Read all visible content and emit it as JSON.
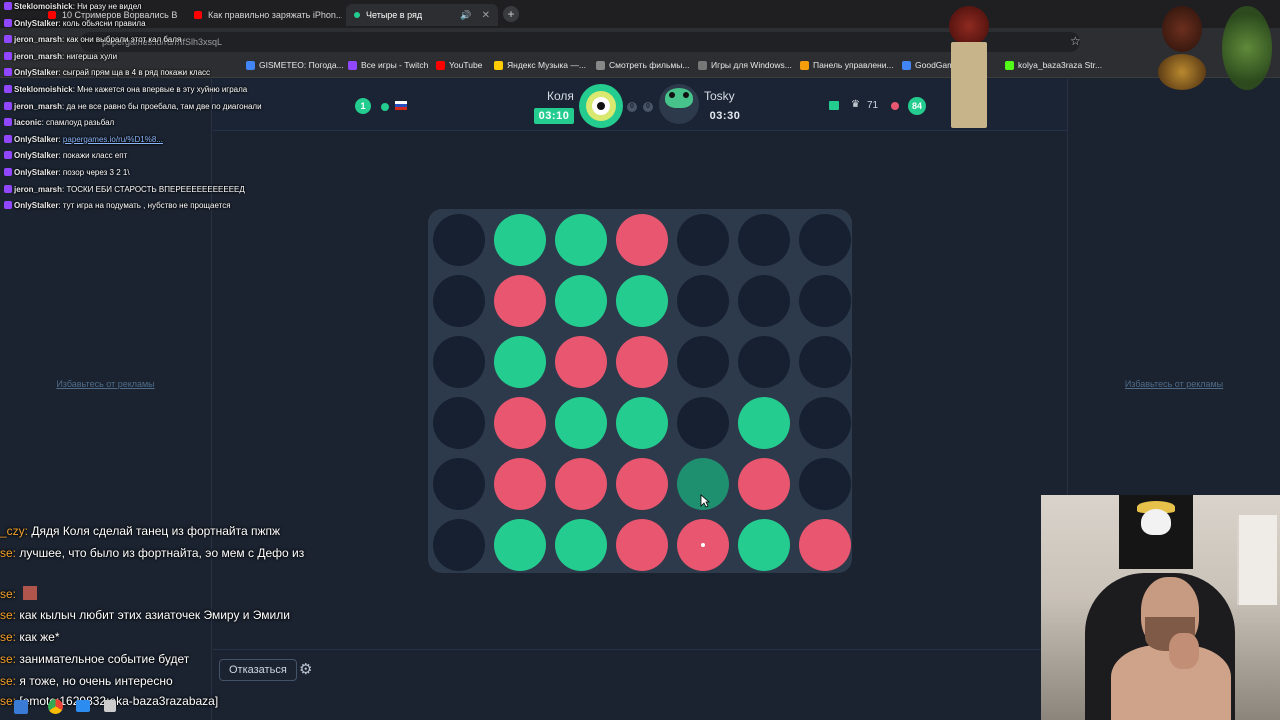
{
  "browser": {
    "tabs": [
      {
        "label": "10 Стримеров Ворвались В Мо...",
        "color": "#ff0000",
        "active": false
      },
      {
        "label": "Как правильно заряжать iPhon...",
        "color": "#ff0000",
        "active": false
      },
      {
        "label": "Четыре в ряд",
        "color": "#24cd8f",
        "active": true
      }
    ],
    "new_tab": "+",
    "url": "papergames.io/ru/r/IfSlh3xsqL",
    "bookmarks": [
      {
        "label": "GISMETEO: Погода...",
        "color": "#4285f4"
      },
      {
        "label": "Все игры - Twitch",
        "color": "#9147ff"
      },
      {
        "label": "YouTube",
        "color": "#ff0000"
      },
      {
        "label": "Яндекс Музыка —...",
        "color": "#ffcc00"
      },
      {
        "label": "Смотреть фильмы...",
        "color": "#888888"
      },
      {
        "label": "Игры для Windows...",
        "color": "#777777"
      },
      {
        "label": "Панель управлени...",
        "color": "#f59e0b"
      },
      {
        "label": "GoodGam...",
        "color": "#4285f4"
      },
      {
        "label": "kolya_baza3raza Str...",
        "color": "#53fc18"
      }
    ]
  },
  "ad_text_left": "Избавьтесь от рекламы",
  "ad_text_right": "Избавьтесь от рекламы",
  "game": {
    "title": "Четыре в ряд",
    "left_badge": "1",
    "player1": {
      "name": "Коля",
      "timer": "03:10",
      "score": "0",
      "color": "#24cd8f"
    },
    "player2": {
      "name": "Tosky",
      "timer": "03:30",
      "score": "0",
      "color": "#e8566f"
    },
    "trophies": "71",
    "right_badge": "84",
    "board": [
      [
        "empty",
        "green",
        "green",
        "red",
        "empty",
        "empty",
        "empty"
      ],
      [
        "empty",
        "red",
        "green",
        "green",
        "empty",
        "empty",
        "empty"
      ],
      [
        "empty",
        "green",
        "red",
        "red",
        "empty",
        "empty",
        "empty"
      ],
      [
        "empty",
        "red",
        "green",
        "green",
        "empty",
        "green",
        "empty"
      ],
      [
        "empty",
        "red",
        "red",
        "red",
        "hover",
        "red",
        "empty"
      ],
      [
        "empty",
        "green",
        "green",
        "red",
        "red-dot",
        "green",
        "red"
      ]
    ],
    "decline_label": "Отказаться"
  },
  "chat_top": [
    {
      "user": "Steklomoishick",
      "msg": "Ни разу не видел"
    },
    {
      "user": "OnlyStalker",
      "msg": "коль обьясни правила"
    },
    {
      "user": "jeron_marsh",
      "msg": "как они выбрали этот кал баля"
    },
    {
      "user": "jeron_marsh",
      "msg": "нигерша хули"
    },
    {
      "user": "OnlyStalker",
      "msg": "сыграй прям ща в 4 в ряд покажи класс"
    },
    {
      "user": "Steklomoishick",
      "msg": "Мне кажется она впервые в эту хуйню играла"
    },
    {
      "user": "jeron_marsh",
      "msg": "да не все равно бы проебала, там две по диагонали"
    },
    {
      "user": "laconic",
      "msg": "спамлоуд разьбал"
    },
    {
      "user": "OnlyStalker",
      "msg": "papergames.io/ru/%D1%8..."
    },
    {
      "user": "OnlyStalker",
      "msg": "покажи класс епт"
    },
    {
      "user": "OnlyStalker",
      "msg": "позор через 3 2 1\\"
    },
    {
      "user": "jeron_marsh",
      "msg": "ТОСКИ ЕБИ СТАРОСТЬ ВПЕРЕЕЕЕЕЕЕЕЕЕЕД"
    },
    {
      "user": "OnlyStalker",
      "msg": "тут игра на подумать , нубство не прощается"
    }
  ],
  "chat_bottom": [
    {
      "prefix": "_czy:",
      "msg": "Дядя Коля сделай танец из фортнайта пжпж"
    },
    {
      "prefix": "se:",
      "msg": "лучшее, что было из фортнайта, эо мем с Дефо из"
    },
    {
      "prefix": "se:",
      "msg": ""
    },
    {
      "prefix": "se:",
      "msg": "как кылыч любит этих азиаточек Эмиру и Эмили"
    },
    {
      "prefix": "se:",
      "msg": "как же*"
    },
    {
      "prefix": "se:",
      "msg": "занимательное событие будет"
    },
    {
      "prefix": "se:",
      "msg": "я тоже, но очень интересно"
    },
    {
      "prefix": "se:",
      "msg": "[emote:1629832:eka-baza3razabaza]"
    }
  ]
}
